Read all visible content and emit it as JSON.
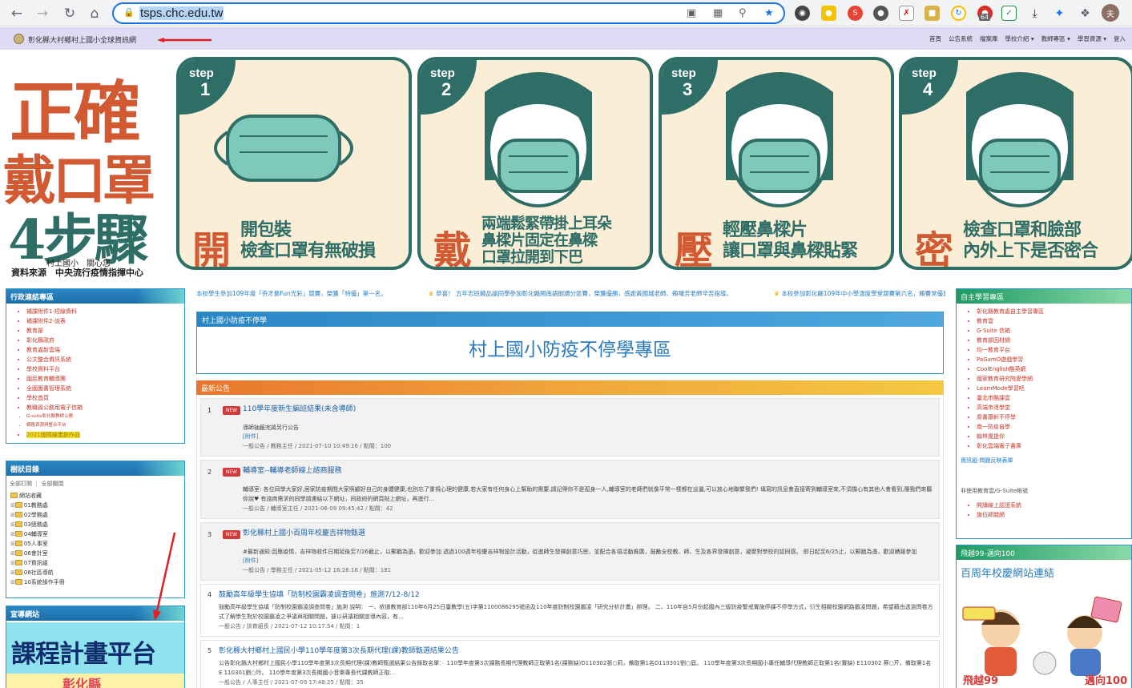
{
  "browser": {
    "url": "tsps.chc.edu.tw",
    "ext_badge": "64",
    "profile_initial": "夫"
  },
  "site": {
    "title": "彰化縣大村鄉村上國小全球資訊網",
    "nav": [
      "首頁",
      "公告系統",
      "檔案庫",
      "學校介紹 ▾",
      "教師專區 ▾",
      "學習資源 ▾",
      "登入"
    ]
  },
  "banner": {
    "left": {
      "line1": "正確",
      "line2": "戴口罩",
      "line3": "4步驟",
      "credit1": "村上國小　關心您",
      "credit2": "資料來源　中央流行疫情指揮中心"
    },
    "steps": [
      {
        "label": "step",
        "num": "1",
        "big": "開",
        "text1": "開包裝",
        "text2": "檢查口罩有無破損",
        "text3": ""
      },
      {
        "label": "step",
        "num": "2",
        "big": "戴",
        "text1": "兩端鬆緊帶掛上耳朵",
        "text2": "鼻樑片固定在鼻樑",
        "text3": "口罩拉開到下巴"
      },
      {
        "label": "step",
        "num": "3",
        "big": "壓",
        "text1": "輕壓鼻樑片",
        "text2": "讓口罩與鼻樑貼緊",
        "text3": ""
      },
      {
        "label": "step",
        "num": "4",
        "big": "密",
        "text1": "檢查口罩和臉部",
        "text2": "內外上下是否密合",
        "text3": ""
      }
    ]
  },
  "marquee": [
    "本校學生參加109年度「夯才藝Fun光彩」競賽，榮獲「特優」第一名。",
    "恭喜！ 五年忠班饒品諭同學參加彰化縣閩南語朗讀分區賽，榮獲優勝，感謝黃國城老師、賴嘯芳老師辛苦指導。",
    "本校參加彰化縣109年中小學溫度學堂競賽第六名，賴賽常優異"
  ],
  "left": {
    "admin": {
      "title": "行政連結專區",
      "links": [
        {
          "text": "補課附件1-短線資料",
          "cls": ""
        },
        {
          "text": "補課附件2-說表",
          "cls": ""
        },
        {
          "text": "教育部",
          "cls": ""
        },
        {
          "text": "彰化縣政府",
          "cls": ""
        },
        {
          "text": "教育處新雲端",
          "cls": ""
        },
        {
          "text": "公文整合資訊系統",
          "cls": ""
        },
        {
          "text": "學校資料平台",
          "cls": ""
        },
        {
          "text": "國民教育輔導團",
          "cls": ""
        },
        {
          "text": "全國圖書管理系統",
          "cls": ""
        },
        {
          "text": "學校首頁",
          "cls": ""
        },
        {
          "text": "教職員公務用電子信箱",
          "cls": ""
        },
        {
          "text": "G-suite彰化縣教師公務",
          "cls": "tiny"
        },
        {
          "text": "網路資源與整合平台",
          "cls": "tiny"
        },
        {
          "text": "2021國際繪畫創作品",
          "cls": "hl"
        }
      ]
    },
    "tree": {
      "title": "樹狀目錄",
      "controls": "全部打開 ｜ 全部關閉",
      "root": "網站收藏",
      "folders": [
        "01教務處",
        "02學務處",
        "03總務處",
        "04輔導室",
        "05人事室",
        "06會計室",
        "07資訊組",
        "08社區導航",
        "10系統操作手冊"
      ]
    },
    "promo": {
      "title": "宣導網站",
      "course_title": "課程計畫平台",
      "course_sub": "彰化縣"
    }
  },
  "center": {
    "covid_title": "村上國小防疫不停學",
    "covid_big": "村上國小防疫不停學專區",
    "news_title": "最新公告",
    "news": [
      {
        "num": "1",
        "tag": "NEW",
        "title": "110學年度新生編班結果(未含導師)",
        "body": "導師抽籤完將另行公告",
        "attach": "[附件]",
        "meta": "一般公告 / 教務主任 / 2021-07-10 10:49:16 / 點閱：100"
      },
      {
        "num": "2",
        "tag": "NEW",
        "title": "輔導室--輔導老師線上諮商服務",
        "body": "輔導室: 各位同學大家好,居家防疫期間大家照顧好自己的身體健康,也別忘了重視心理的健康,若大家有任何身心上幫助的需要,請記得你不是孤身一人,輔導室的老師們就像平常一樣都在這邊,可以放心地聯繫我們! 填寫的訊息會直接寄到輔導室來,不須擔心有其他人會看到,隨我們來聽你說♥ 有諮商需求的同學請連結以下網址，同政府的網頁貼上網址，再進行...",
        "attach": "",
        "meta": "一般公告 / 輔導室主任 / 2021-06-09 09:45:42 / 點閱：42"
      },
      {
        "num": "3",
        "tag": "NEW",
        "title": "彰化縣村上國小百周年校慶吉祥物甄選",
        "body": "#最新通知:因應疫情，吉祥物收件日期延後至7/26截止，以郵戳為憑，歡迎參加 透過100週年校慶吉祥物設計活動，從進師生發揮創意巧思，並配合各項活動推廣，鼓勵全校教、師、生及各界發揮創意，凝聚對學校的認同感。 即日起至6/25止，以郵戳為憑，歡迎踴躍參加",
        "attach": "[附件]",
        "meta": "一般公告 / 學務主任 / 2021-05-12 16:26:16 / 點閱：181"
      },
      {
        "num": "4",
        "tag": "",
        "title": "鼓勵高年級學生協填「防制校園霸凌調查問卷」施測7/12-8/12",
        "body": "鼓勵高年級學生協填「防制校園霸凌調查問卷」施測 說明： 一、依據教育部110年6月25日臺教學(五)字第1100086295號函及110年度防制校園霸凌「研究分析計畫」辦理。 二、110年自5月份起國內三級防疫警戒實施停課不停學方式，衍生相關校園網路霸凌問題，希望藉由透過問卷方式了解學生對於校園霸凌之爭議與相關問題，據以研議相關宣導內容，有...",
        "attach": "",
        "meta": "一般公告 / 訓育組長 / 2021-07-12 10:17:54 / 點閱：1"
      },
      {
        "num": "5",
        "tag": "",
        "title": "彰化縣大村鄉村上國民小學110學年度第3次長期代理(課)教師甄選結果公告",
        "body": "公告彰化縣大村鄉村上國民小學110學年度第3次長期代理(課)教師甄選結果公告錄取名單： 110學年度第3次課務長期代理教師正取第1名(課務缺)D110302張○莉，備取第1名D110301劉○庭。 110學年度第3次長期國小專任輔導代理教師正取第1名(實缺) E110302 蔡○芹，備取第1名E 110301劉○玲。 110學年度第3次長期國小音樂專長代課教師正取...",
        "attach": "",
        "meta": "一般公告 / 人事主任 / 2021-07-09 17:48:25 / 點閱：35"
      }
    ]
  },
  "right": {
    "self_learn": {
      "title": "自主學習專區",
      "links": [
        "彰化縣教育處自主學習專區",
        "教育雲",
        "G-Suite 信箱",
        "教育部因材網",
        "均一教育平台",
        "PaGamO遊戲學習",
        "CoolEnglish酷英網",
        "國家教育研究院愛學網",
        "LearnMode學習吧",
        "臺北市酷課雲",
        "高端市達學堂",
        "原書康軒不停學",
        "南一防疫自學",
        "翰林風提你",
        "彰化雲端電子書庫"
      ],
      "support": "資訊組-問題反映表單",
      "note": "非使用教育雲/G-Suite帳號",
      "links2": [
        "開讀線上認證系統",
        "旗位師閱網"
      ]
    },
    "anniv": {
      "title": "飛越99-邁向100",
      "link": "百周年校慶網站連結"
    }
  }
}
